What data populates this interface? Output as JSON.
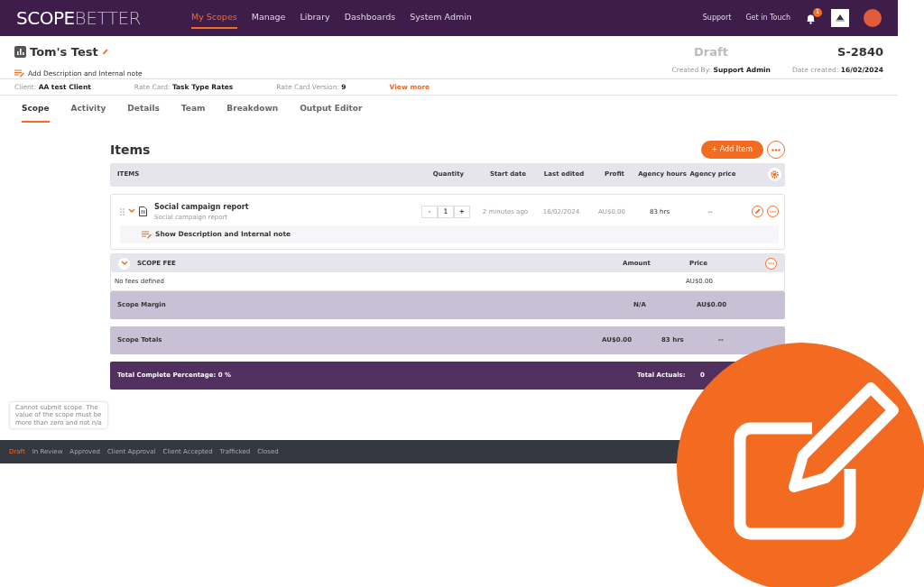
{
  "brand": {
    "left": "SCOPE",
    "right": "BETTER"
  },
  "nav": [
    {
      "label": "My Scopes",
      "selected": true
    },
    {
      "label": "Manage",
      "selected": false
    },
    {
      "label": "Library",
      "selected": false
    },
    {
      "label": "Dashboards",
      "selected": false
    },
    {
      "label": "System Admin",
      "selected": false
    }
  ],
  "nav_right": {
    "links": [
      "Support",
      "Get in Touch"
    ],
    "notifications": "1"
  },
  "scope": {
    "title": "Tom's Test",
    "add_note": "Add Description and Internal note",
    "status": "Draft",
    "number": "S-2840",
    "created_by_label": "Created By:",
    "created_by": "Support Admin",
    "date_label": "Date created:",
    "date": "16/02/2024"
  },
  "meta": [
    {
      "label": "Client:",
      "value": "AA test Client"
    },
    {
      "label": "Rate Card:",
      "value": "Task Type Rates"
    },
    {
      "label": "Rate Card Version:",
      "value": "9"
    }
  ],
  "view_more": "View more",
  "tabs": [
    {
      "label": "Scope",
      "selected": true
    },
    {
      "label": "Activity",
      "selected": false
    },
    {
      "label": "Details",
      "selected": false
    },
    {
      "label": "Team",
      "selected": false
    },
    {
      "label": "Breakdown",
      "selected": false
    },
    {
      "label": "Output Editor",
      "selected": false
    }
  ],
  "items_title": "Items",
  "add_item": "+ Add Item",
  "columns": [
    "ITEMS",
    "Quantity",
    "Start date",
    "Last edited",
    "Profit",
    "Agency hours",
    "Agency price"
  ],
  "items": [
    {
      "name": "Social campaign report",
      "subtitle": "Social campaign report",
      "expanded": true,
      "minus": "-",
      "quantity": "1",
      "plus": "+",
      "start": "2 minutes ago",
      "last_edited": "16/02/2024",
      "profit": "AU$0.00",
      "hours": "83 hrs",
      "price": "--",
      "note_link": "Show Description and Internal note"
    }
  ],
  "fee": {
    "title": "SCOPE FEE",
    "amount_label": "Amount",
    "price_label": "Price",
    "empty": "No fees defined",
    "price": "AU$0.00"
  },
  "margin": {
    "label": "Scope Margin",
    "value_1": "N/A",
    "value_2": "AU$0.00"
  },
  "totals": {
    "label": "Scope Totals",
    "value_1": "AU$0.00",
    "value_2": "83 hrs",
    "value_3": "--"
  },
  "complete": {
    "label": "Total Complete Percentage: 0 %",
    "actuals_label": "Total Actuals:",
    "actuals": "0"
  },
  "tooltip": "Cannot submit scope. The value of the scope must be more than zero and not n/a",
  "statuses": [
    {
      "label": "Draft",
      "selected": true
    },
    {
      "label": "In Review",
      "selected": false
    },
    {
      "label": "Approved",
      "selected": false
    },
    {
      "label": "Client Approval",
      "selected": false
    },
    {
      "label": "Client Accepted",
      "selected": false
    },
    {
      "label": "Trafficked",
      "selected": false
    },
    {
      "label": "Closed",
      "selected": false
    }
  ]
}
